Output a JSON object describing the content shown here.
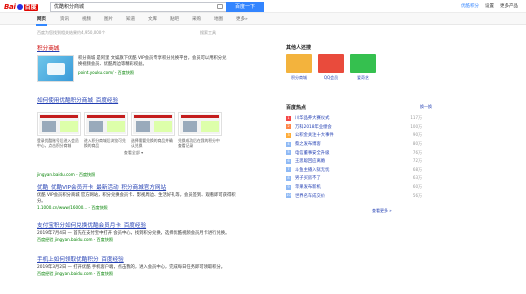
{
  "header": {
    "logo_text_a": "Bai",
    "logo_text_b": "百度",
    "search_value": "优酷积分商城",
    "search_button": "百度一下",
    "user_links": [
      "优酷积分",
      "设置",
      "更多产品"
    ]
  },
  "tabs": [
    "网页",
    "资讯",
    "视频",
    "图片",
    "知道",
    "文库",
    "贴吧",
    "采购",
    "地图",
    "更多»"
  ],
  "result_stats": "百度为您找到相关结果约4,950,000个",
  "search_tools": "搜索工具",
  "results": {
    "r1": {
      "title_pre": "",
      "title_em": "积分商城",
      "desc": "积分商城 是阿里 文娱旗下优酷 VIP会员专享积分兑换平台，会员可以用积分兑换视频会员、优酷周边等精彩权益。",
      "url": "point.youku.com/ - 百度快照"
    },
    "r2": {
      "title": "如何使用优酷积分商城_百度经验",
      "captions": [
        "登录优酷账号后进入会员中心，点击积分商城",
        "进入积分商城后浏览可兑换的商品",
        "选择需要兑换的商品并确认兑换",
        "兑换成功后在我的积分中查看记录"
      ],
      "more": "查看全部 ▾",
      "url": "jingyan.baidu.com - 百度快照"
    },
    "r3": {
      "title": "优酷_优酷VIP会员开卡_最新活动_积分商城官方网站",
      "desc": "优酷 VIP会员积分商城 官方网站，积分兑换会员卡、影视周边、生活好礼等，会员签到、观看即可获得积分。",
      "url": "1.1000.cn/www/16000... - 百度快照"
    },
    "r4": {
      "title": "支付宝积分如何兑换优酷会员月卡_百度经验",
      "desc": "2019年7月4日 — 首先在支付宝中打开 会员中心，找到积分兑换，选择优酷视频会员月卡进行兑换。",
      "url": "百度经验 jingyan.baidu.com - 百度快照"
    },
    "r5": {
      "title": "手机上如何领取优酷积分_百度经验",
      "desc": "2019年3月2日 — 打开优酷 手机客户端，点击我的，进入会员中心，完成每日任务即可领取积分。",
      "url": "百度经验 jingyan.baidu.com - 百度快照"
    }
  },
  "sidebar": {
    "people_title": "其他人还搜",
    "people": [
      {
        "name": "积分商城",
        "color": "#f3b33d"
      },
      {
        "name": "QQ会员",
        "color": "#e94b3c"
      },
      {
        "name": "爱奇艺",
        "color": "#35c04f"
      }
    ],
    "hot_title": "百度热点",
    "hot_more": "换一换",
    "hot": [
      {
        "rank": "1",
        "text": "川华品养大赛仪式",
        "value": "117万",
        "color": "#f54545"
      },
      {
        "rank": "2",
        "text": "万科2018年业绩会",
        "value": "100万",
        "color": "#ff8547"
      },
      {
        "rank": "3",
        "text": "公积金关注十大事件",
        "value": "90万",
        "color": "#ffac38"
      },
      {
        "name": "",
        "rank": "4",
        "text": "蔡之发布博客",
        "value": "80万",
        "color": "#8eb9f5"
      },
      {
        "rank": "5",
        "text": "电信董事安全升级",
        "value": "76万",
        "color": "#8eb9f5"
      },
      {
        "rank": "6",
        "text": "王思聪回应离婚",
        "value": "72万",
        "color": "#8eb9f5"
      },
      {
        "rank": "7",
        "text": "斗鱼主播入狱无忧",
        "value": "68万",
        "color": "#8eb9f5"
      },
      {
        "rank": "8",
        "text": "男子买房不了",
        "value": "63万",
        "color": "#8eb9f5"
      },
      {
        "rank": "9",
        "text": "苹果发布新机",
        "value": "60万",
        "color": "#8eb9f5"
      },
      {
        "rank": "10",
        "text": "世界名车成交价",
        "value": "56万",
        "color": "#8eb9f5"
      }
    ],
    "hot_footer": "查看更多 »"
  }
}
